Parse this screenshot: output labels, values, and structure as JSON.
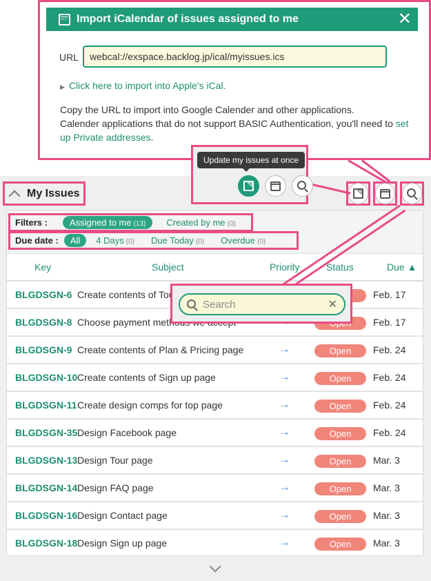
{
  "ical_popup": {
    "title": "Import iCalendar of issues assigned to me",
    "close_label": "✕",
    "url_label": "URL",
    "url_value": "webcal://exspace.backlog.jp/ical/myissues.ics",
    "apple_link": "Click here to import into Apple's iCal.",
    "text_line1": "Copy the URL to import into Google Calender and other applications.",
    "text_line2": "Calender applications that do not support BASIC Authentication, you'll need to ",
    "private_link": "set up Private addresses",
    "text_end": "."
  },
  "tooltip": {
    "text": "Update my issues at once"
  },
  "section": {
    "title": "My Issues"
  },
  "filters": {
    "label": "Filters :",
    "items": [
      {
        "label": "Assigned to me",
        "count": "(13)",
        "active": true
      },
      {
        "label": "Created by me",
        "count": "(0)",
        "active": false
      }
    ]
  },
  "due_filters": {
    "label": "Due date :",
    "items": [
      {
        "label": "All",
        "count": "",
        "active": true
      },
      {
        "label": "4 Days",
        "count": "(0)",
        "active": false
      },
      {
        "label": "Due Today",
        "count": "(0)",
        "active": false
      },
      {
        "label": "Overdue",
        "count": "(0)",
        "active": false
      }
    ]
  },
  "table": {
    "columns": {
      "key": "Key",
      "subject": "Subject",
      "priority": "Priority",
      "status": "Status",
      "due": "Due ▲"
    },
    "rows": [
      {
        "key": "BLGDSGN-6",
        "subject": "Create contents of Tour page",
        "priority": "→",
        "status": "Open",
        "due": "Feb. 17"
      },
      {
        "key": "BLGDSGN-8",
        "subject": "Choose payment methods we accept",
        "priority": "→",
        "status": "Open",
        "due": "Feb. 17"
      },
      {
        "key": "BLGDSGN-9",
        "subject": "Create contents of Plan & Pricing page",
        "priority": "→",
        "status": "Open",
        "due": "Feb. 24"
      },
      {
        "key": "BLGDSGN-10",
        "subject": "Create contents of Sign up page",
        "priority": "→",
        "status": "Open",
        "due": "Feb. 24"
      },
      {
        "key": "BLGDSGN-11",
        "subject": "Create design comps for top page",
        "priority": "→",
        "status": "Open",
        "due": "Feb. 24"
      },
      {
        "key": "BLGDSGN-35",
        "subject": "Design Facebook page",
        "priority": "→",
        "status": "Open",
        "due": "Feb. 24"
      },
      {
        "key": "BLGDSGN-13",
        "subject": "Design Tour page",
        "priority": "→",
        "status": "Open",
        "due": "Mar. 3"
      },
      {
        "key": "BLGDSGN-14",
        "subject": "Design FAQ page",
        "priority": "→",
        "status": "Open",
        "due": "Mar. 3"
      },
      {
        "key": "BLGDSGN-16",
        "subject": "Design Contact page",
        "priority": "→",
        "status": "Open",
        "due": "Mar. 3"
      },
      {
        "key": "BLGDSGN-18",
        "subject": "Design Sign up page",
        "priority": "→",
        "status": "Open",
        "due": "Mar. 3"
      }
    ]
  },
  "search": {
    "placeholder": "Search",
    "clear_label": "✕"
  },
  "colors": {
    "brand": "#1e9b79",
    "highlight": "#e94b86",
    "status_open": "#f0857a",
    "priority_normal": "#4a90d9"
  }
}
